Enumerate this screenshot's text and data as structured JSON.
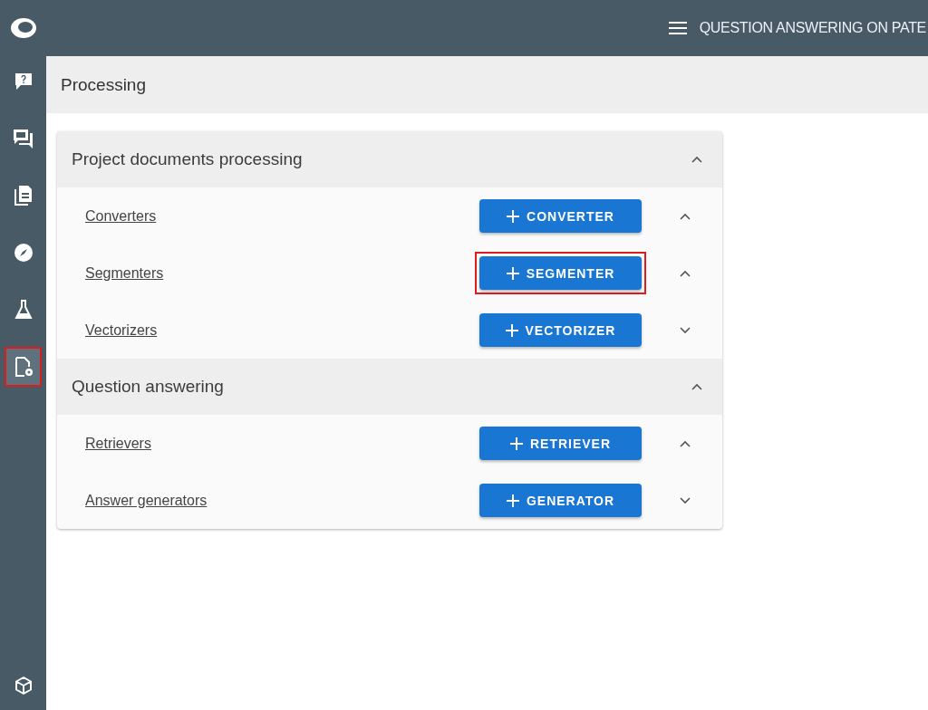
{
  "sidebar": {
    "items": [
      {
        "kind": "question",
        "selected": false,
        "highlighted": false
      },
      {
        "kind": "discussion",
        "selected": false,
        "highlighted": false
      },
      {
        "kind": "documents",
        "selected": false,
        "highlighted": false
      },
      {
        "kind": "compass",
        "selected": false,
        "highlighted": false
      },
      {
        "kind": "flask",
        "selected": false,
        "highlighted": false
      },
      {
        "kind": "doc-settings",
        "selected": true,
        "highlighted": true
      }
    ]
  },
  "topbar": {
    "title": "QUESTION ANSWERING ON PATE"
  },
  "page": {
    "title": "Processing"
  },
  "sections": [
    {
      "title": "Project documents processing",
      "expanded": true,
      "rows": [
        {
          "label": "Converters",
          "button": "CONVERTER",
          "expanded": true,
          "highlighted": false
        },
        {
          "label": "Segmenters",
          "button": "SEGMENTER",
          "expanded": true,
          "highlighted": true
        },
        {
          "label": "Vectorizers",
          "button": "VECTORIZER",
          "expanded": false,
          "highlighted": false
        }
      ]
    },
    {
      "title": "Question answering",
      "expanded": true,
      "rows": [
        {
          "label": "Retrievers",
          "button": "RETRIEVER",
          "expanded": true,
          "highlighted": false
        },
        {
          "label": "Answer generators",
          "button": "GENERATOR",
          "expanded": false,
          "highlighted": false
        }
      ]
    }
  ]
}
